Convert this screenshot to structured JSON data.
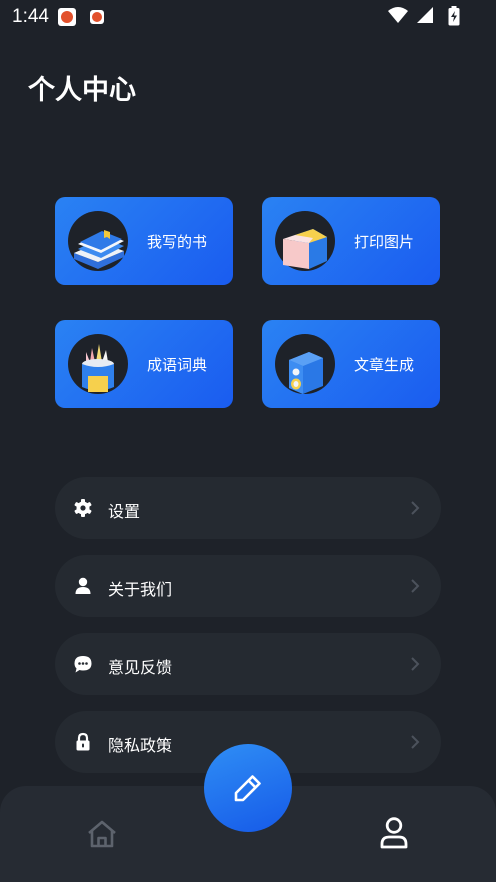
{
  "status_bar": {
    "time": "1:44",
    "icons": [
      "app-notification-icon",
      "app-notification-icon",
      "wifi-icon",
      "signal-icon",
      "battery-charging-icon"
    ]
  },
  "page": {
    "title": "个人中心"
  },
  "features": [
    {
      "label": "我写的书",
      "icon": "books-icon"
    },
    {
      "label": "打印图片",
      "icon": "photo-print-icon"
    },
    {
      "label": "成语词典",
      "icon": "pencil-cup-icon"
    },
    {
      "label": "文章生成",
      "icon": "speaker-box-icon"
    }
  ],
  "menu": [
    {
      "label": "设置",
      "icon": "gear-icon"
    },
    {
      "label": "关于我们",
      "icon": "person-icon"
    },
    {
      "label": "意见反馈",
      "icon": "chat-bubble-icon"
    },
    {
      "label": "隐私政策",
      "icon": "lock-icon"
    }
  ],
  "bottom_nav": {
    "items": [
      "home-icon",
      "profile-icon"
    ],
    "fab_icon": "pencil-icon",
    "active": "profile"
  },
  "colors": {
    "background": "#1e2229",
    "card_gradient_start": "#2a82f3",
    "card_gradient_end": "#1a5cf0",
    "menu_item_bg": "#252a31",
    "nav_bg": "#262b33"
  }
}
